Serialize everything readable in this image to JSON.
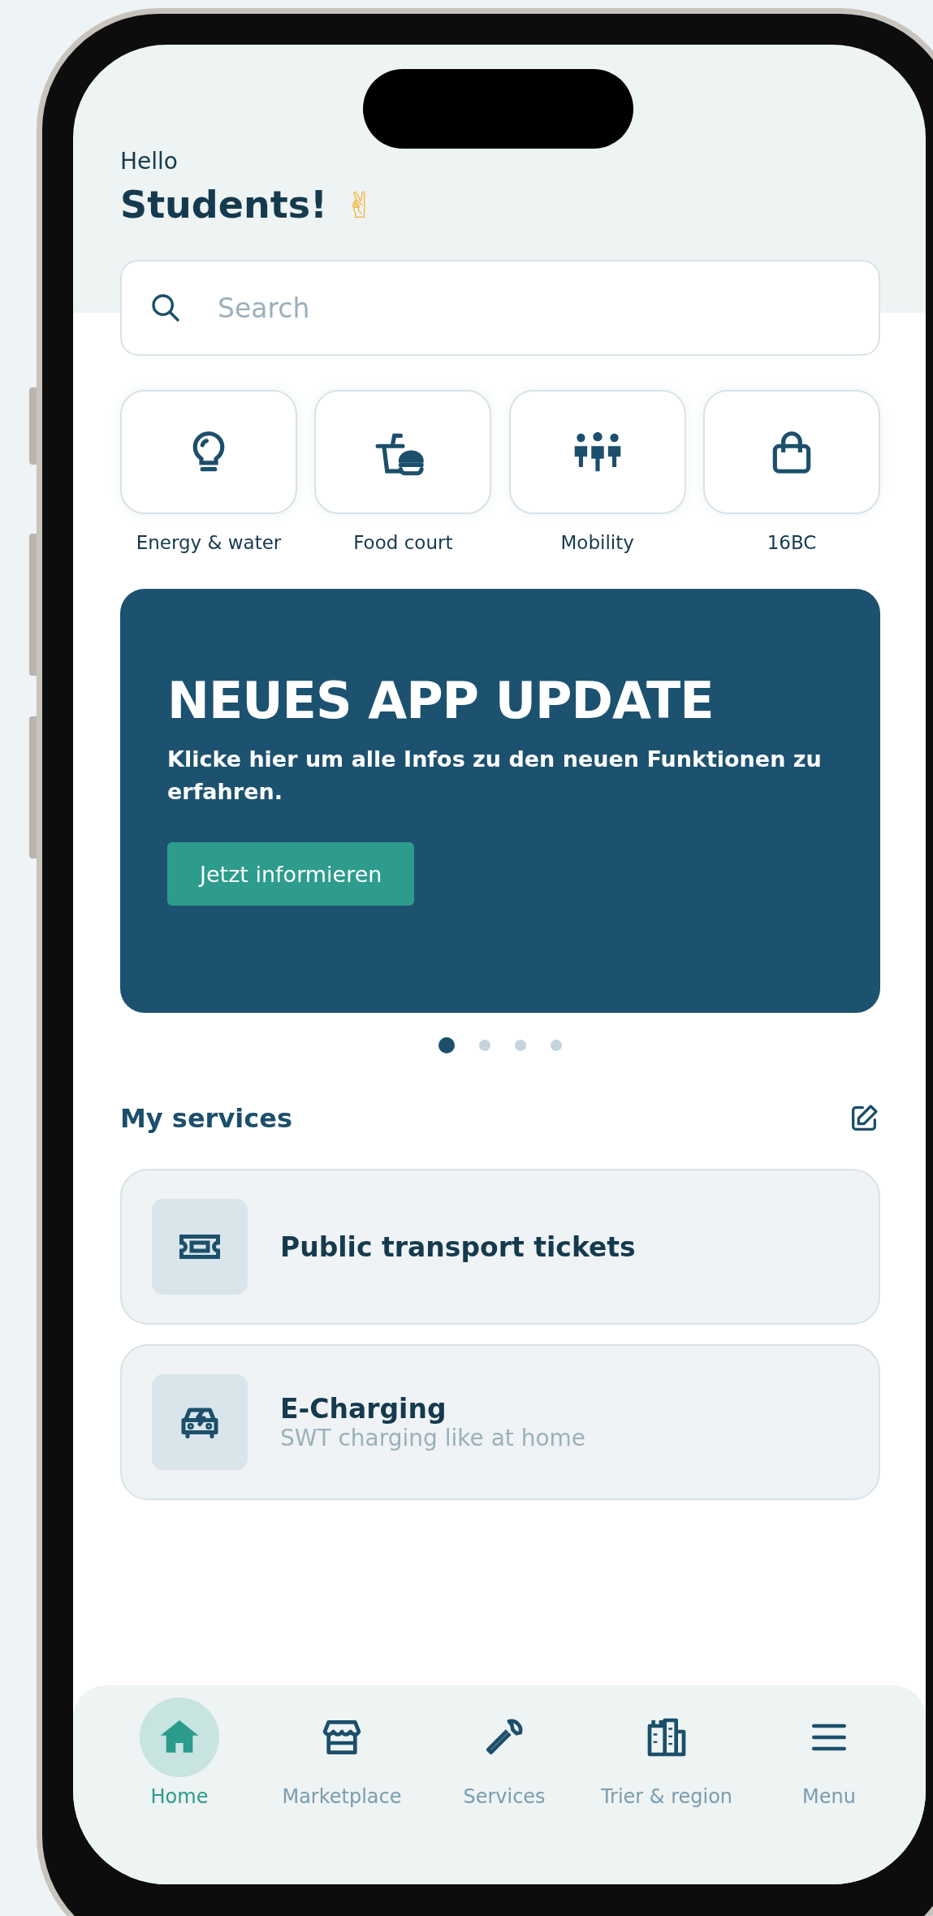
{
  "greeting": "Hello",
  "title": "Students!",
  "emoji": "✌",
  "search": {
    "placeholder": "Search"
  },
  "quick_actions": [
    {
      "label": "Energy & water"
    },
    {
      "label": "Food court"
    },
    {
      "label": "Mobility"
    },
    {
      "label": "16BC"
    }
  ],
  "banner": {
    "title": "NEUES APP UPDATE",
    "text": "Klicke hier um alle Infos zu den neuen Funktionen zu erfahren.",
    "button": "Jetzt informieren"
  },
  "carousel_dots": [
    {
      "selected": true
    },
    {
      "selected": false
    },
    {
      "selected": false
    },
    {
      "selected": false
    }
  ],
  "services": {
    "title": "My services",
    "items": [
      {
        "title": "Public transport tickets"
      },
      {
        "title": "E-Charging",
        "subtitle": "SWT charging like at home"
      }
    ]
  },
  "nav": [
    {
      "label": "Home",
      "selected": true
    },
    {
      "label": "Marketplace",
      "selected": false
    },
    {
      "label": "Services",
      "selected": false
    },
    {
      "label": "Trier & region",
      "selected": false
    },
    {
      "label": "Menu",
      "selected": false
    }
  ]
}
